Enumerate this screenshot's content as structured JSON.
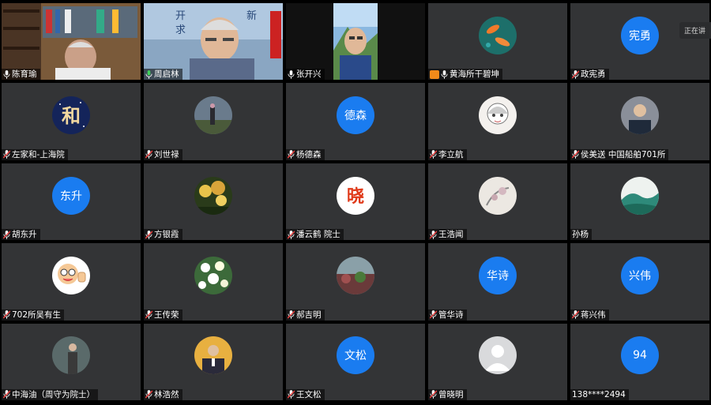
{
  "speaking_label": "正在讲",
  "participants": [
    {
      "name": "陈育瑜",
      "type": "video",
      "mic": "on"
    },
    {
      "name": "周启林",
      "type": "video",
      "mic": "on-green"
    },
    {
      "name": "张开兴",
      "type": "video",
      "mic": "on"
    },
    {
      "name": "黄海所干碧坤",
      "type": "image-avatar",
      "mic": "badge",
      "avatar": "koi-fish-icon"
    },
    {
      "name": "政宪勇",
      "type": "text-avatar",
      "avatar_text": "宪勇",
      "mic": "muted"
    },
    {
      "name": "左家和-上海院",
      "type": "image-avatar",
      "avatar": "he-character-icon",
      "mic": "muted"
    },
    {
      "name": "刘世禄",
      "type": "image-avatar",
      "avatar": "photo-icon",
      "mic": "muted"
    },
    {
      "name": "杨德森",
      "type": "text-avatar",
      "avatar_text": "德森",
      "mic": "muted"
    },
    {
      "name": "李立航",
      "type": "image-avatar",
      "avatar": "anime-girl-icon",
      "mic": "muted"
    },
    {
      "name": "侯美送 中国船舶701所",
      "type": "image-avatar",
      "avatar": "man-portrait-icon",
      "mic": "muted"
    },
    {
      "name": "胡东升",
      "type": "text-avatar",
      "avatar_text": "东升",
      "mic": "muted"
    },
    {
      "name": "方银霞",
      "type": "image-avatar",
      "avatar": "flower-tree-icon",
      "mic": "muted"
    },
    {
      "name": "潘云鹤 院士",
      "type": "image-avatar",
      "avatar": "xiao-character-icon",
      "mic": "muted"
    },
    {
      "name": "王浩闻",
      "type": "image-avatar",
      "avatar": "ink-painting-icon",
      "mic": "muted"
    },
    {
      "name": "孙杨",
      "type": "image-avatar",
      "avatar": "landscape-painting-icon",
      "mic": "none"
    },
    {
      "name": "702所吴有生",
      "type": "image-avatar",
      "avatar": "cartoon-thumbs-up-icon",
      "mic": "muted"
    },
    {
      "name": "王传荣",
      "type": "image-avatar",
      "avatar": "flowers-icon",
      "mic": "muted"
    },
    {
      "name": "郝吉明",
      "type": "image-avatar",
      "avatar": "garden-photo-icon",
      "mic": "muted"
    },
    {
      "name": "管华诗",
      "type": "text-avatar",
      "avatar_text": "华诗",
      "mic": "muted"
    },
    {
      "name": "蒋兴伟",
      "type": "text-avatar",
      "avatar_text": "兴伟",
      "mic": "muted"
    },
    {
      "name": "中海油（周守为院士）",
      "type": "image-avatar",
      "avatar": "man-standing-icon",
      "mic": "muted"
    },
    {
      "name": "林浩然",
      "type": "image-avatar",
      "avatar": "man-suit-icon",
      "mic": "muted"
    },
    {
      "name": "王文松",
      "type": "text-avatar",
      "avatar_text": "文松",
      "mic": "muted"
    },
    {
      "name": "曾晓明",
      "type": "image-avatar",
      "avatar": "default-user-icon",
      "mic": "muted"
    },
    {
      "name": "138****2494",
      "type": "text-avatar",
      "avatar_text": "94",
      "mic": "none"
    }
  ]
}
